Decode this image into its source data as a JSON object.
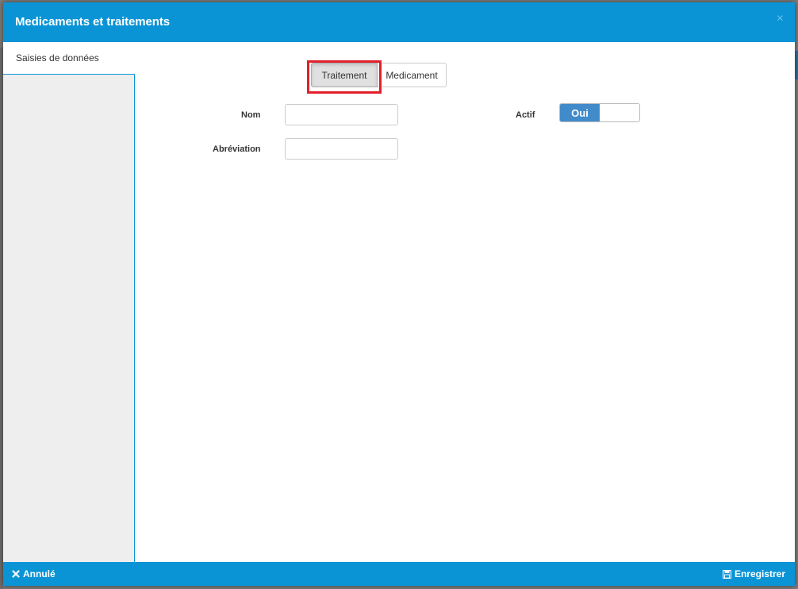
{
  "modal": {
    "title": "Medicaments et traitements",
    "close_glyph": "×"
  },
  "sidebar": {
    "tab_label": "Saisies de données"
  },
  "type_toggle": {
    "options": [
      {
        "label": "Traitement",
        "active": true
      },
      {
        "label": "Medicament",
        "active": false
      }
    ]
  },
  "form": {
    "nom_label": "Nom",
    "nom_value": "",
    "abreviation_label": "Abréviation",
    "abreviation_value": "",
    "actif_label": "Actif",
    "actif_on_label": "Oui",
    "actif_value": true
  },
  "footer": {
    "cancel_label": "Annulé",
    "cancel_icon": "times-icon",
    "save_label": "Enregistrer",
    "save_icon": "floppy-disk-icon"
  },
  "colors": {
    "header": "#0a94d6",
    "highlight": "#e0202a",
    "switch_on": "#428bca"
  }
}
